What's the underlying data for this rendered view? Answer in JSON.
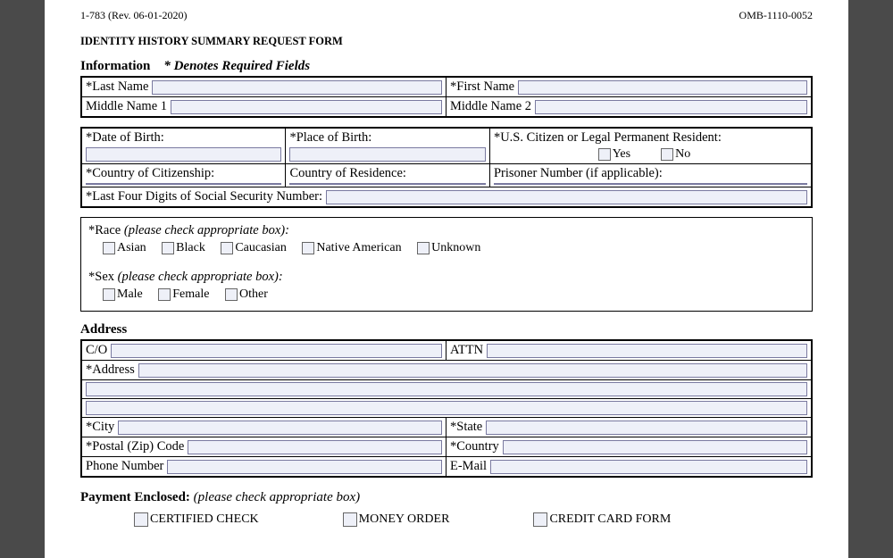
{
  "header": {
    "left": "1-783 (Rev. 06-01-2020)",
    "right": "OMB-1110-0052"
  },
  "title": "IDENTITY HISTORY SUMMARY REQUEST FORM",
  "info": {
    "heading": "Information",
    "required_note": "* Denotes Required Fields",
    "last_name": "*Last Name",
    "first_name": "*First Name",
    "middle1": "Middle Name 1",
    "middle2": "Middle Name 2",
    "dob": "*Date of Birth:",
    "pob": "*Place of Birth:",
    "citizen_q": "*U.S. Citizen or Legal Permanent Resident:",
    "yes": "Yes",
    "no": "No",
    "coc": "*Country of Citizenship:",
    "cor": "Country of Residence:",
    "prisoner": "Prisoner Number (if applicable):",
    "ssn": "*Last Four Digits of Social Security Number:"
  },
  "race": {
    "heading": "*Race",
    "note": "(please check appropriate box):",
    "options": [
      "Asian",
      "Black",
      "Caucasian",
      "Native American",
      "Unknown"
    ]
  },
  "sex": {
    "heading": "*Sex",
    "note": "(please check appropriate box):",
    "options": [
      "Male",
      "Female",
      "Other"
    ]
  },
  "address": {
    "heading": "Address",
    "co": "C/O",
    "attn": "ATTN",
    "address": "*Address",
    "city": "*City",
    "state": "*State",
    "zip": "*Postal (Zip) Code",
    "country": "*Country",
    "phone": "Phone Number",
    "email": "E-Mail"
  },
  "payment": {
    "heading": "Payment Enclosed:",
    "note": "(please check appropriate box)",
    "options": [
      "CERTIFIED CHECK",
      "MONEY ORDER",
      "CREDIT CARD FORM"
    ]
  }
}
